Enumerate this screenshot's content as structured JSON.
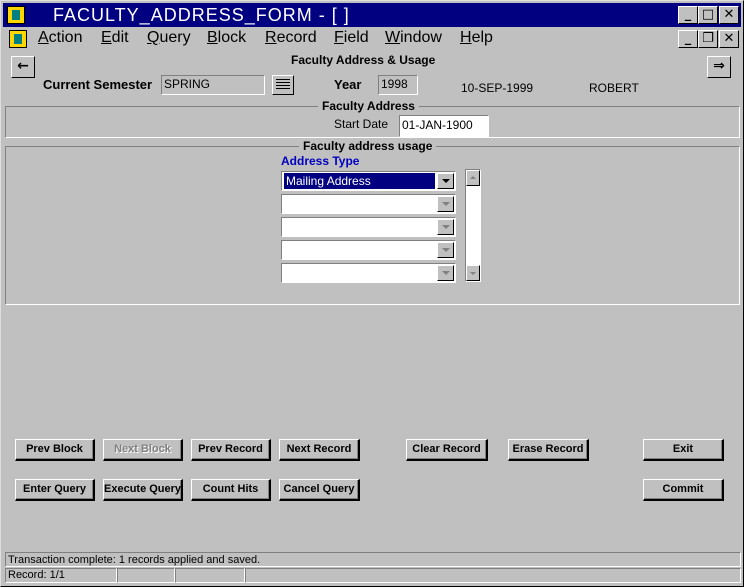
{
  "window": {
    "title": "FACULTY_ADDRESS_FORM - [ ]"
  },
  "title_controls": {
    "minimize": "_",
    "maximize": "□",
    "close": "✕"
  },
  "doc_controls": {
    "minimize": "_",
    "restore": "❐",
    "close": "✕"
  },
  "menu": [
    {
      "label": "Action",
      "mnemonic": "A",
      "rest": "ction"
    },
    {
      "label": "Edit",
      "mnemonic": "E",
      "rest": "dit"
    },
    {
      "label": "Query",
      "mnemonic": "Q",
      "rest": "uery"
    },
    {
      "label": "Block",
      "mnemonic": "B",
      "rest": "lock"
    },
    {
      "label": "Record",
      "mnemonic": "R",
      "rest": "ecord"
    },
    {
      "label": "Field",
      "mnemonic": "F",
      "rest": "ield"
    },
    {
      "label": "Window",
      "mnemonic": "W",
      "rest": "indow"
    },
    {
      "label": "Help",
      "mnemonic": "H",
      "rest": "elp"
    }
  ],
  "header": {
    "form_title": "Faculty Address & Usage",
    "back_arrow": "←",
    "forward_arrow": "⇒",
    "semester_label": "Current Semester",
    "semester_value": "SPRING",
    "year_label": "Year",
    "year_value": "1998",
    "date": "10-SEP-1999",
    "user": "ROBERT"
  },
  "faculty_address": {
    "title": "Faculty Address",
    "start_date_label": "Start Date",
    "start_date_value": "01-JAN-1900"
  },
  "usage": {
    "title": "Faculty address usage",
    "column_label": "Address Type",
    "column_color": "#0000c0",
    "rows": [
      "Mailing Address",
      "",
      "",
      "",
      ""
    ]
  },
  "buttons": {
    "prev_block": "Prev Block",
    "next_block": "Next Block",
    "prev_record": "Prev Record",
    "next_record": "Next Record",
    "clear_record": "Clear Record",
    "erase_record": "Erase Record",
    "exit": "Exit",
    "enter_query": "Enter Query",
    "execute_query": "Execute Query",
    "count_hits": "Count Hits",
    "cancel_query": "Cancel Query",
    "commit": "Commit"
  },
  "status": {
    "message": "Transaction complete: 1 records applied and saved.",
    "record": "Record: 1/1"
  },
  "colors": {
    "title_bar": "#000080",
    "face": "#c0c0c0",
    "selection": "#000080"
  }
}
